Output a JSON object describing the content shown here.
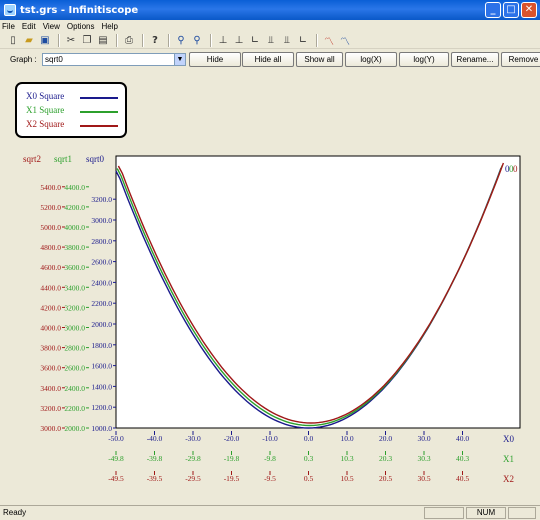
{
  "window": {
    "title": "tst.grs - Infinitiscope",
    "min": "_",
    "max": "□",
    "close": "✕"
  },
  "menu": [
    "File",
    "Edit",
    "View",
    "Options",
    "Help"
  ],
  "toolbar_icons": [
    "new-icon",
    "open-icon",
    "save-icon",
    "cut-icon",
    "copy-icon",
    "paste-icon",
    "print-icon",
    "help-icon",
    "zoom-in-icon",
    "zoom-out-icon",
    "graph-layout-1-icon",
    "graph-layout-2-icon",
    "graph-layout-3-icon",
    "graph-layout-4-icon",
    "graph-layout-5-icon",
    "graph-layout-6-icon",
    "curve-red-icon",
    "curve-blue-icon"
  ],
  "graphbar": {
    "label": "Graph :",
    "selected": "sqrt0",
    "buttons": [
      "Hide",
      "Hide all",
      "Show all",
      "log(X)",
      "log(Y)",
      "Rename...",
      "Remove"
    ]
  },
  "legend": [
    {
      "name": "X0 Square",
      "color": "#1a1a8c"
    },
    {
      "name": "X1 Square",
      "color": "#2ca02c"
    },
    {
      "name": "X2 Square",
      "color": "#a01818"
    }
  ],
  "colors": {
    "blue": "#1a1a8c",
    "green": "#2ca02c",
    "red": "#a01818"
  },
  "chart_data": {
    "type": "line",
    "y_axes": [
      {
        "name": "sqrt2",
        "color": "#a01818",
        "ticks": [
          "5400.0",
          "5200.0",
          "5000.0",
          "4800.0",
          "4600.0",
          "4400.0",
          "4200.0",
          "4000.0",
          "3800.0",
          "3600.0",
          "3400.0",
          "3200.0",
          "3000.0"
        ]
      },
      {
        "name": "sqrt1",
        "color": "#2ca02c",
        "ticks": [
          "4400.0",
          "4200.0",
          "4000.0",
          "3800.0",
          "3600.0",
          "3400.0",
          "3200.0",
          "3000.0",
          "2800.0",
          "2600.0",
          "2400.0",
          "2200.0",
          "2000.0"
        ]
      },
      {
        "name": "sqrt0",
        "color": "#1a1a8c",
        "ticks": [
          "3200.0",
          "3000.0",
          "2800.0",
          "2600.0",
          "2400.0",
          "2200.0",
          "2000.0",
          "1800.0",
          "1600.0",
          "1400.0",
          "1200.0",
          "1000.0"
        ]
      }
    ],
    "x_axes": [
      {
        "name": "X0",
        "color": "#1a1a8c",
        "ticks": [
          "-50.0",
          "-40.0",
          "-30.0",
          "-20.0",
          "-10.0",
          "0.0",
          "10.0",
          "20.0",
          "30.0",
          "40.0"
        ]
      },
      {
        "name": "X1",
        "color": "#2ca02c",
        "ticks": [
          "-49.8",
          "-39.8",
          "-29.8",
          "-19.8",
          "-9.8",
          "0.3",
          "10.3",
          "20.3",
          "30.3",
          "40.3"
        ]
      },
      {
        "name": "X2",
        "color": "#a01818",
        "ticks": [
          "-49.5",
          "-39.5",
          "-29.5",
          "-19.5",
          "-9.5",
          "0.5",
          "10.5",
          "20.5",
          "30.5",
          "40.5"
        ]
      }
    ],
    "series": [
      {
        "name": "X0 Square",
        "color": "#1a1a8c",
        "x_range": [
          -50,
          50
        ],
        "formula": "x^2 + 1000"
      },
      {
        "name": "X1 Square",
        "color": "#2ca02c",
        "x_range": [
          -49.75,
          50.25
        ],
        "formula": "x^2 + 2000"
      },
      {
        "name": "X2 Square",
        "color": "#a01818",
        "x_range": [
          -49.5,
          50.5
        ],
        "formula": "x^2 + 3000"
      }
    ],
    "end_labels": [
      "0",
      "0",
      "0"
    ]
  },
  "status": {
    "text": "Ready",
    "num": "NUM"
  }
}
